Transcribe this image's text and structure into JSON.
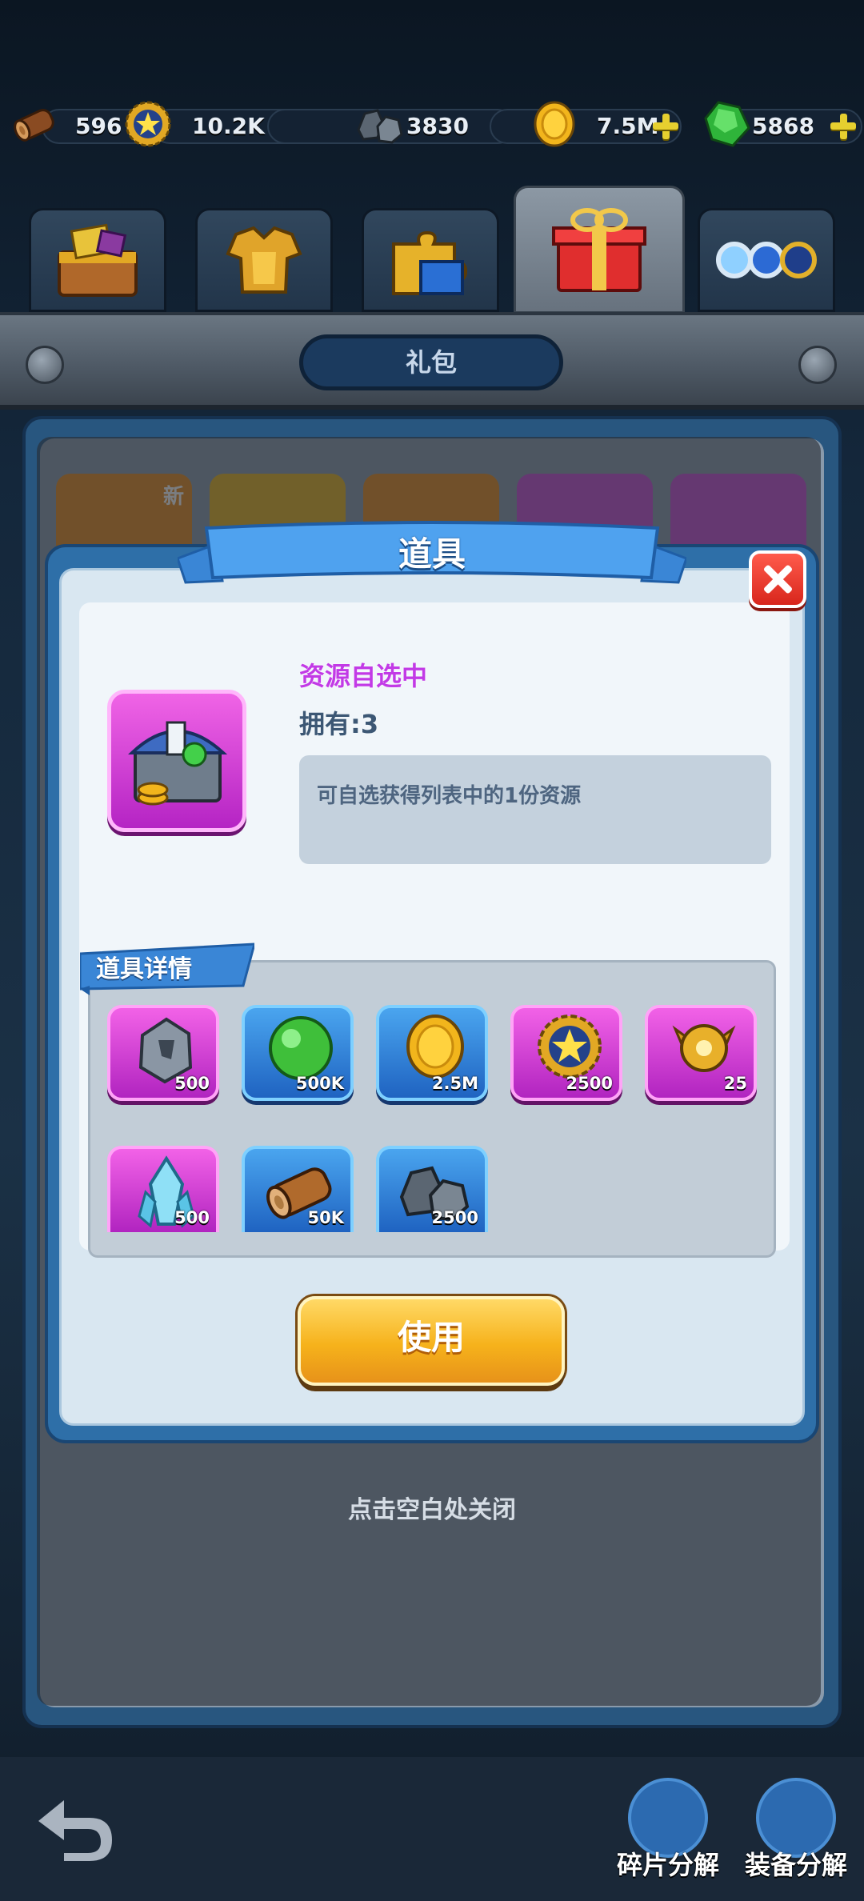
{
  "resources": [
    {
      "icon": "wood-log-icon",
      "value": "596"
    },
    {
      "icon": "star-medal-icon",
      "value": "10.2K"
    },
    {
      "icon": "iron-ore-icon",
      "value": "3830"
    },
    {
      "icon": "gold-coin-icon",
      "value": "7.5M",
      "plus": true
    },
    {
      "icon": "green-gem-icon",
      "value": "5868",
      "plus": true
    }
  ],
  "tabs": [
    {
      "name": "treasure-chest-tab",
      "icon": "treasure-chest-icon"
    },
    {
      "name": "armor-tab",
      "icon": "armor-icon"
    },
    {
      "name": "puzzle-tab",
      "icon": "puzzle-piece-icon"
    },
    {
      "name": "gift-tab",
      "icon": "gift-box-icon",
      "active": true
    },
    {
      "name": "orbs-tab",
      "icon": "orbs-icon"
    }
  ],
  "section_title": "礼包",
  "background_cards": {
    "new_badge": "新"
  },
  "modal": {
    "title": "道具",
    "item": {
      "name": "资源自选中",
      "owned_label": "拥有:",
      "owned_count": "3",
      "description": "可自选获得列表中的1份资源"
    },
    "details_label": "道具详情",
    "rewards": [
      {
        "icon": "rune-stone-icon",
        "count": "500",
        "frame": "purple"
      },
      {
        "icon": "exp-orb-icon",
        "count": "500K",
        "frame": "blue"
      },
      {
        "icon": "gold-coin-icon",
        "count": "2.5M",
        "frame": "blue"
      },
      {
        "icon": "star-medal-icon",
        "count": "2500",
        "frame": "purple"
      },
      {
        "icon": "gold-emblem-icon",
        "count": "25",
        "frame": "purple"
      },
      {
        "icon": "blue-crystal-icon",
        "count": "500",
        "frame": "purple"
      },
      {
        "icon": "wood-log-icon",
        "count": "50K",
        "frame": "blue"
      },
      {
        "icon": "iron-ore-icon",
        "count": "2500",
        "frame": "blue"
      }
    ],
    "use_button": "使用"
  },
  "close_hint": "点击空白处关闭",
  "bottom_bar": {
    "fragment_decompose": "碎片分解",
    "equipment_decompose": "装备分解"
  },
  "colors": {
    "modal_frame": "#2e6fa8",
    "item_name": "#c23ae6",
    "use_button": "#f6b21b",
    "close_button": "#e0322a"
  }
}
